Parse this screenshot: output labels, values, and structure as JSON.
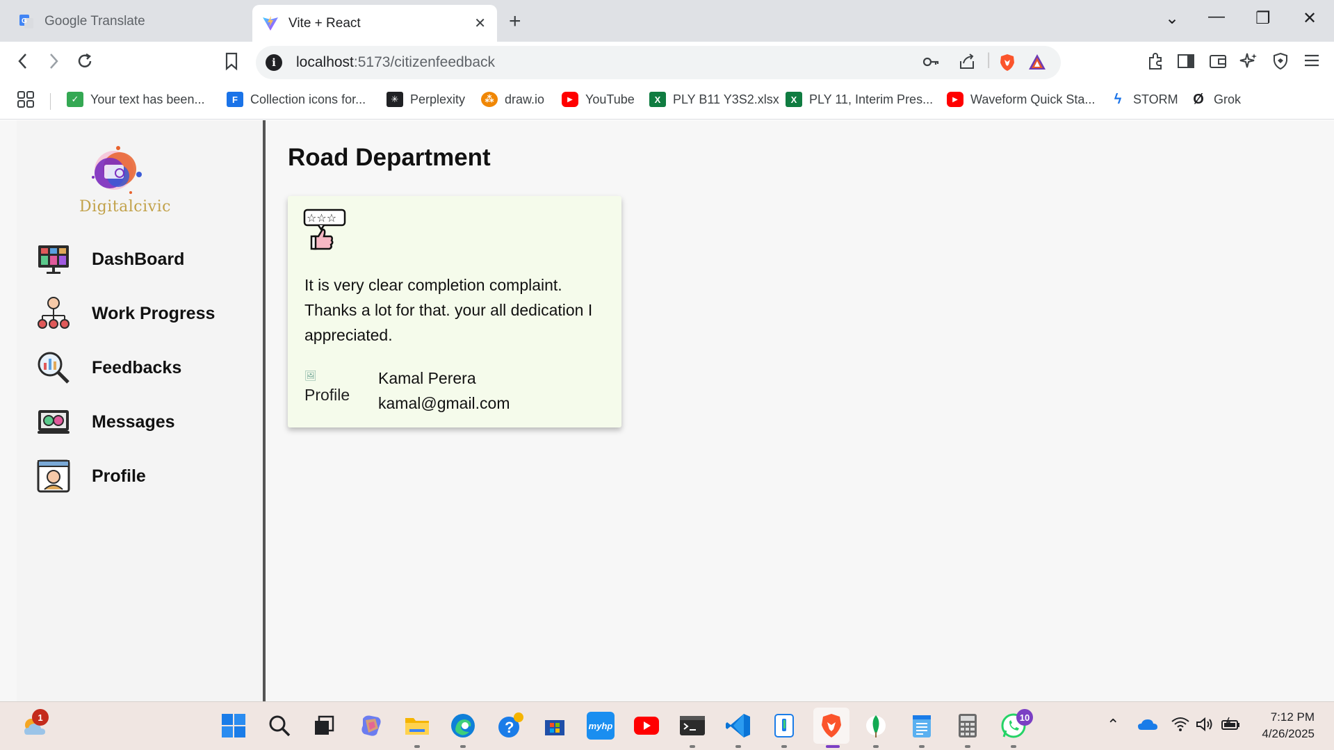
{
  "browser": {
    "tabs": [
      {
        "label": "Google Translate",
        "active": false,
        "icon": "google-translate-icon"
      },
      {
        "label": "Vite + React",
        "active": true,
        "icon": "vite-icon"
      }
    ],
    "address_host": "localhost",
    "address_path": ":5173/citizenfeedback",
    "bookmarks": [
      {
        "label": "Your text has been...",
        "icon": "checkbox-icon",
        "color": "#34a853"
      },
      {
        "label": "Collection icons for...",
        "icon": "flaticon-icon",
        "color": "#1a73e8"
      },
      {
        "label": "Perplexity",
        "icon": "perplexity-icon",
        "color": "#202124"
      },
      {
        "label": "draw.io",
        "icon": "drawio-icon",
        "color": "#f08705"
      },
      {
        "label": "YouTube",
        "icon": "youtube-icon",
        "color": "#ff0000"
      },
      {
        "label": "PLY B11 Y3S2.xlsx",
        "icon": "excel-icon",
        "color": "#107c41"
      },
      {
        "label": "PLY 11, Interim Pres...",
        "icon": "excel-icon",
        "color": "#107c41"
      },
      {
        "label": "Waveform Quick Sta...",
        "icon": "youtube-icon",
        "color": "#ff0000"
      },
      {
        "label": "STORM",
        "icon": "storm-icon",
        "color": "#1a73e8"
      },
      {
        "label": "Grok",
        "icon": "grok-icon",
        "color": "#202124"
      }
    ]
  },
  "app": {
    "logo_text": "Digitalcivic",
    "nav": [
      {
        "label": "DashBoard",
        "icon": "dashboard-icon"
      },
      {
        "label": "Work Progress",
        "icon": "work-progress-icon"
      },
      {
        "label": "Feedbacks",
        "icon": "feedbacks-icon"
      },
      {
        "label": "Messages",
        "icon": "messages-icon"
      },
      {
        "label": "Profile",
        "icon": "profile-icon"
      }
    ],
    "page_title": "Road Department",
    "feedback": {
      "text": "It is very clear completion complaint. Thanks a lot for that. your all dedication I appreciated.",
      "image_alt": "Profile",
      "name": "Kamal Perera",
      "email": "kamal@gmail.com"
    }
  },
  "taskbar": {
    "weather_badge": "1",
    "whatsapp_badge": "10",
    "time": "7:12 PM",
    "date": "4/26/2025"
  },
  "colors": {
    "accent_brave": "#fb542b",
    "card_bg": "#f5fbeb",
    "sidebar_border": "#555555"
  }
}
